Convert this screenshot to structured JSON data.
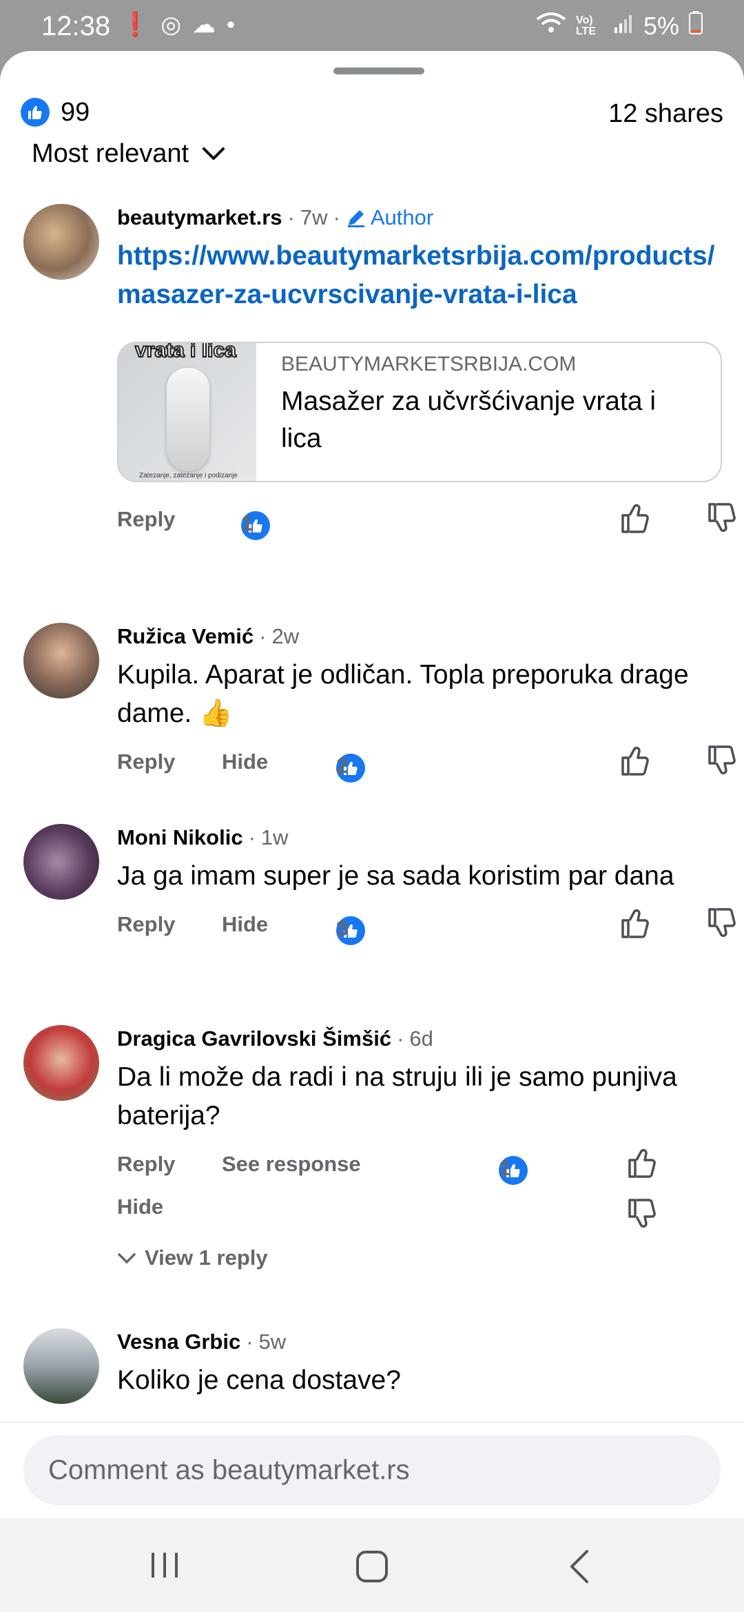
{
  "status": {
    "time": "12:38",
    "battery": "5%",
    "lte": "Vo) LTE"
  },
  "summary": {
    "like_count": "99",
    "shares": "12 shares"
  },
  "sort": {
    "label": "Most relevant"
  },
  "comments": [
    {
      "name": "beautymarket.rs",
      "time": "7w",
      "author_label": "Author",
      "link_text": "https://www.beautymarketsrbija.com/products/masazer-za-ucvrscivanje-vrata-i-lica",
      "preview": {
        "domain": "BEAUTYMARKETSRBIJA.COM",
        "title": "Masažer za učvršćivanje vrata i lica",
        "thumb_caption": "vrata i lica",
        "thumb_footer": "Zatezanje, zatezanje i podizanje"
      },
      "reply": "Reply",
      "likes": "1"
    },
    {
      "name": "Ružica Vemić",
      "time": "2w",
      "text": "Kupila. Aparat je odličan. Topla preporuka drage dame. 👍",
      "reply": "Reply",
      "hide": "Hide",
      "likes": "2"
    },
    {
      "name": "Moni Nikolic",
      "time": "1w",
      "text": "Ja ga imam super je sa sada koristim par dana",
      "reply": "Reply",
      "hide": "Hide",
      "likes": "3"
    },
    {
      "name": "Dragica Gavrilovski Šimšić",
      "time": "6d",
      "text": "Da li može da radi i na struju ili je samo punjiva baterija?",
      "reply": "Reply",
      "see_response": "See response",
      "hide": "Hide",
      "likes": "1",
      "view_replies": "View 1 reply"
    },
    {
      "name": "Vesna Grbic",
      "time": "5w",
      "text": "Koliko je cena dostave?"
    }
  ],
  "composer": {
    "placeholder": "Comment as beautymarket.rs"
  },
  "colors": {
    "accent": "#1877f2",
    "link": "#0a66c2",
    "secondary_text": "#65676b"
  },
  "icons": [
    "like-icon",
    "thumb-up-icon",
    "thumb-down-icon",
    "chevron-down-icon",
    "pencil-icon",
    "wifi-icon",
    "signal-icon",
    "battery-icon",
    "recents-icon",
    "home-icon",
    "back-icon"
  ]
}
